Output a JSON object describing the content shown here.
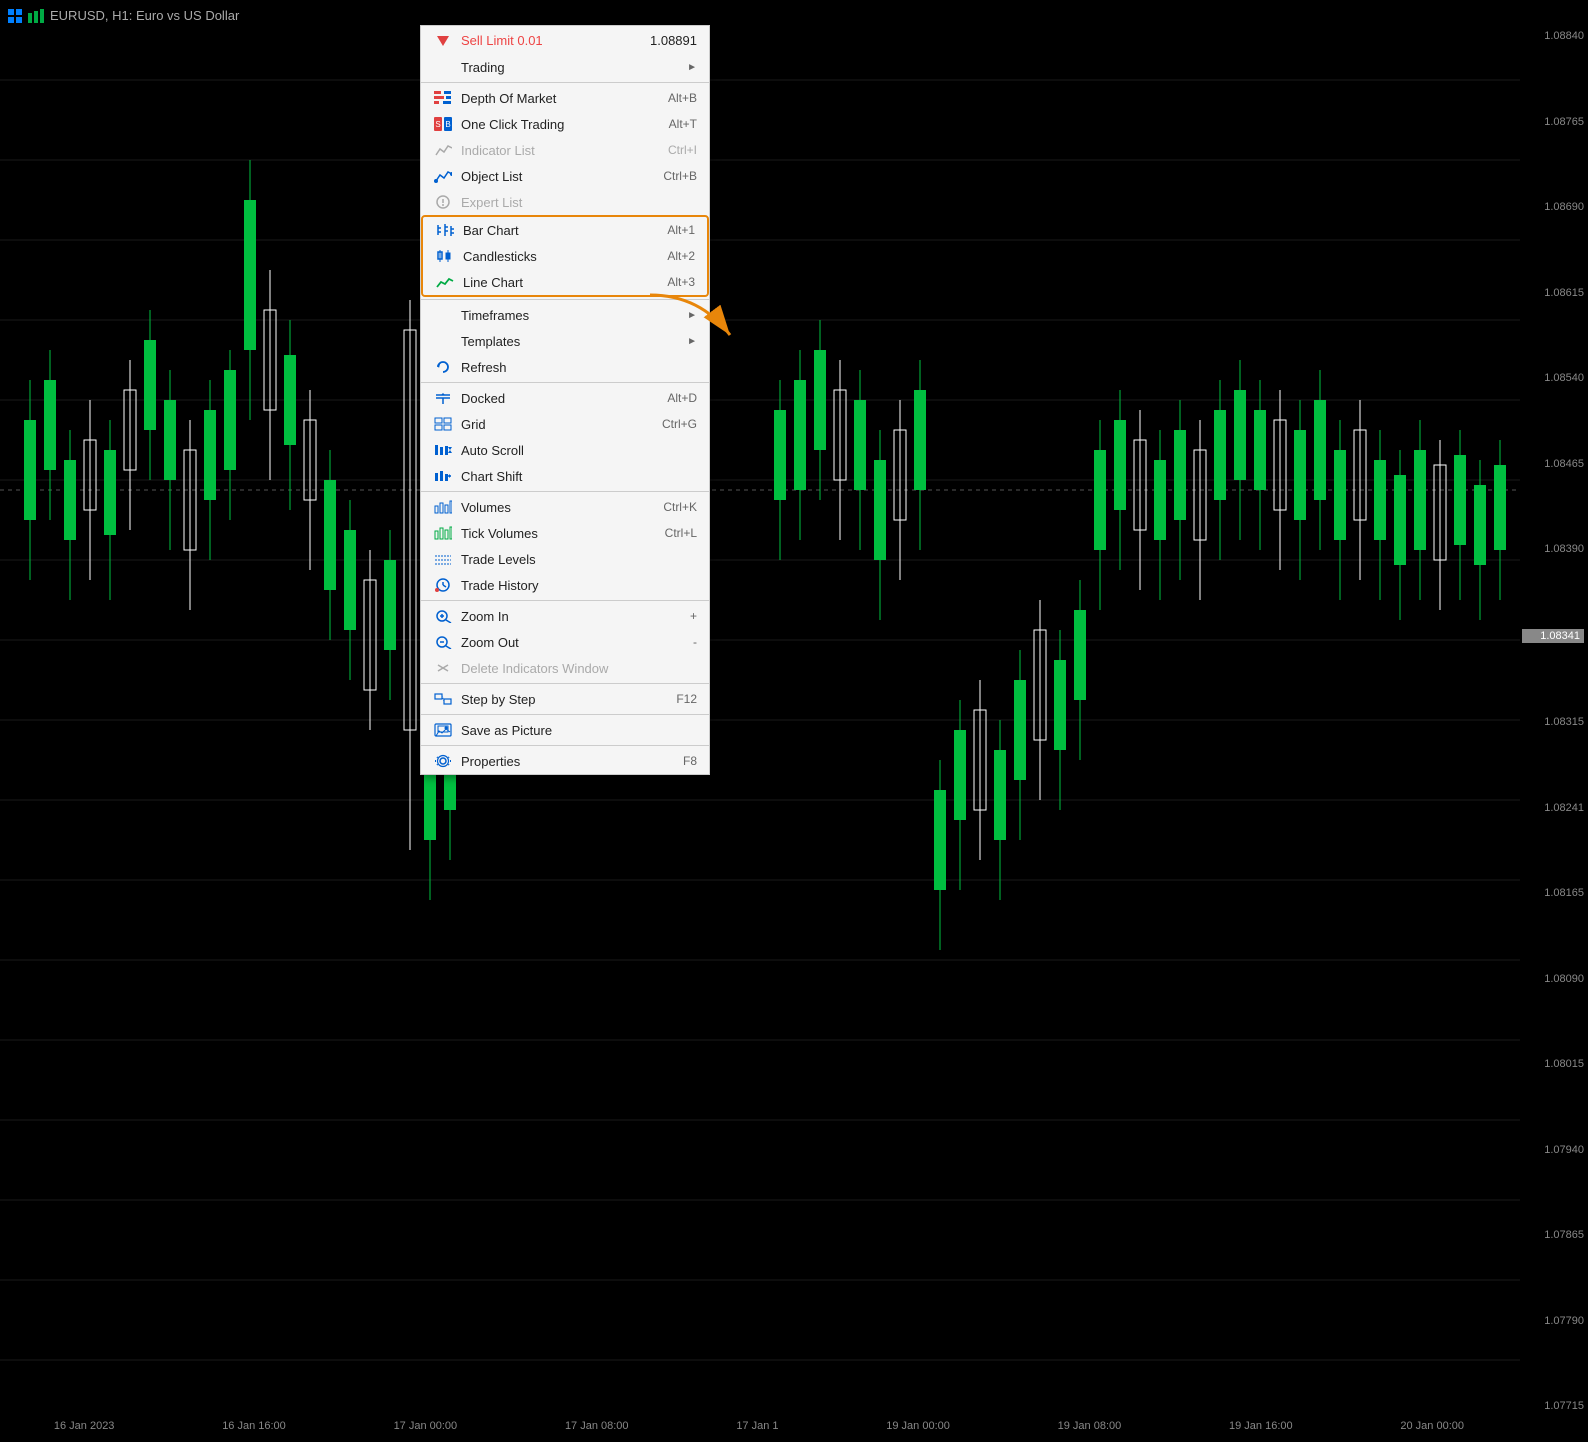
{
  "titleBar": {
    "icons": [
      "grid-icon",
      "chart-icon"
    ],
    "text": "EURUSD, H1:  Euro vs US Dollar"
  },
  "priceAxis": {
    "prices": [
      "1.08840",
      "1.08765",
      "1.08690",
      "1.08615",
      "1.08540",
      "1.08465",
      "1.08390",
      "1.08315",
      "1.08241",
      "1.08165",
      "1.08090",
      "1.08015",
      "1.07940",
      "1.07865",
      "1.07790",
      "1.07715"
    ],
    "currentPrice": "1.08341"
  },
  "timeAxis": {
    "labels": [
      "16 Jan 2023",
      "16 Jan 16:00",
      "17 Jan 00:00",
      "17 Jan 08:00",
      "17 Jan 1",
      "19 Jan 00:00",
      "19 Jan 08:00",
      "19 Jan 16:00",
      "20 Jan 00:00"
    ]
  },
  "contextMenu": {
    "sellLimit": {
      "label": "Sell Limit 0.01",
      "price": "1.08891"
    },
    "items": [
      {
        "id": "trading",
        "icon": "arrow-icon",
        "label": "Trading",
        "shortcut": "",
        "hasArrow": true,
        "disabled": false,
        "separator": false
      },
      {
        "id": "sep1",
        "separator": true
      },
      {
        "id": "depth-of-market",
        "icon": "dom-icon",
        "label": "Depth Of Market",
        "shortcut": "Alt+B",
        "hasArrow": false,
        "disabled": false,
        "separator": false
      },
      {
        "id": "one-click-trading",
        "icon": "oct-icon",
        "label": "One Click Trading",
        "shortcut": "Alt+T",
        "hasArrow": false,
        "disabled": false,
        "separator": false
      },
      {
        "id": "indicator-list",
        "icon": "indicator-icon",
        "label": "Indicator List",
        "shortcut": "Ctrl+I",
        "hasArrow": false,
        "disabled": true,
        "separator": false
      },
      {
        "id": "object-list",
        "icon": "object-icon",
        "label": "Object List",
        "shortcut": "Ctrl+B",
        "hasArrow": false,
        "disabled": false,
        "separator": false
      },
      {
        "id": "expert-list",
        "icon": "expert-icon",
        "label": "Expert List",
        "shortcut": "",
        "hasArrow": false,
        "disabled": true,
        "separator": false
      },
      {
        "id": "sep2",
        "separator": true
      },
      {
        "id": "bar-chart",
        "icon": "bar-icon",
        "label": "Bar Chart",
        "shortcut": "Alt+1",
        "hasArrow": false,
        "disabled": false,
        "separator": false,
        "highlighted": true
      },
      {
        "id": "candlesticks",
        "icon": "candle-icon",
        "label": "Candlesticks",
        "shortcut": "Alt+2",
        "hasArrow": false,
        "disabled": false,
        "separator": false,
        "highlighted": true
      },
      {
        "id": "line-chart",
        "icon": "line-icon",
        "label": "Line Chart",
        "shortcut": "Alt+3",
        "hasArrow": false,
        "disabled": false,
        "separator": false,
        "highlighted": true
      },
      {
        "id": "sep3",
        "separator": true
      },
      {
        "id": "timeframes",
        "icon": "tf-icon",
        "label": "Timeframes",
        "shortcut": "",
        "hasArrow": true,
        "disabled": false,
        "separator": false
      },
      {
        "id": "templates",
        "icon": "tmpl-icon",
        "label": "Templates",
        "shortcut": "",
        "hasArrow": true,
        "disabled": false,
        "separator": false
      },
      {
        "id": "refresh",
        "icon": "refresh-icon",
        "label": "Refresh",
        "shortcut": "",
        "hasArrow": false,
        "disabled": false,
        "separator": false
      },
      {
        "id": "sep4",
        "separator": true
      },
      {
        "id": "docked",
        "icon": "dock-icon",
        "label": "Docked",
        "shortcut": "Alt+D",
        "hasArrow": false,
        "disabled": false,
        "separator": false
      },
      {
        "id": "grid",
        "icon": "grid-menu-icon",
        "label": "Grid",
        "shortcut": "Ctrl+G",
        "hasArrow": false,
        "disabled": false,
        "separator": false
      },
      {
        "id": "auto-scroll",
        "icon": "autoscroll-icon",
        "label": "Auto Scroll",
        "shortcut": "",
        "hasArrow": false,
        "disabled": false,
        "separator": false
      },
      {
        "id": "chart-shift",
        "icon": "chartshift-icon",
        "label": "Chart Shift",
        "shortcut": "",
        "hasArrow": false,
        "disabled": false,
        "separator": false
      },
      {
        "id": "sep5",
        "separator": true
      },
      {
        "id": "volumes",
        "icon": "vol-icon",
        "label": "Volumes",
        "shortcut": "Ctrl+K",
        "hasArrow": false,
        "disabled": false,
        "separator": false
      },
      {
        "id": "tick-volumes",
        "icon": "tickvol-icon",
        "label": "Tick Volumes",
        "shortcut": "Ctrl+L",
        "hasArrow": false,
        "disabled": false,
        "separator": false
      },
      {
        "id": "trade-levels",
        "icon": "tradelevel-icon",
        "label": "Trade Levels",
        "shortcut": "",
        "hasArrow": false,
        "disabled": false,
        "separator": false
      },
      {
        "id": "trade-history",
        "icon": "tradehist-icon",
        "label": "Trade History",
        "shortcut": "",
        "hasArrow": false,
        "disabled": false,
        "separator": false
      },
      {
        "id": "sep6",
        "separator": true
      },
      {
        "id": "zoom-in",
        "icon": "zoomin-icon",
        "label": "Zoom In",
        "shortcut": "+",
        "hasArrow": false,
        "disabled": false,
        "separator": false
      },
      {
        "id": "zoom-out",
        "icon": "zoomout-icon",
        "label": "Zoom Out",
        "shortcut": "-",
        "hasArrow": false,
        "disabled": false,
        "separator": false
      },
      {
        "id": "delete-indicators",
        "icon": "delete-icon",
        "label": "Delete Indicators Window",
        "shortcut": "",
        "hasArrow": false,
        "disabled": true,
        "separator": false
      },
      {
        "id": "sep7",
        "separator": true
      },
      {
        "id": "step-by-step",
        "icon": "step-icon",
        "label": "Step by Step",
        "shortcut": "F12",
        "hasArrow": false,
        "disabled": false,
        "separator": false
      },
      {
        "id": "sep8",
        "separator": true
      },
      {
        "id": "save-as-picture",
        "icon": "save-icon",
        "label": "Save as Picture",
        "shortcut": "",
        "hasArrow": false,
        "disabled": false,
        "separator": false
      },
      {
        "id": "sep9",
        "separator": true
      },
      {
        "id": "properties",
        "icon": "props-icon",
        "label": "Properties",
        "shortcut": "F8",
        "hasArrow": false,
        "disabled": false,
        "separator": false
      }
    ]
  }
}
